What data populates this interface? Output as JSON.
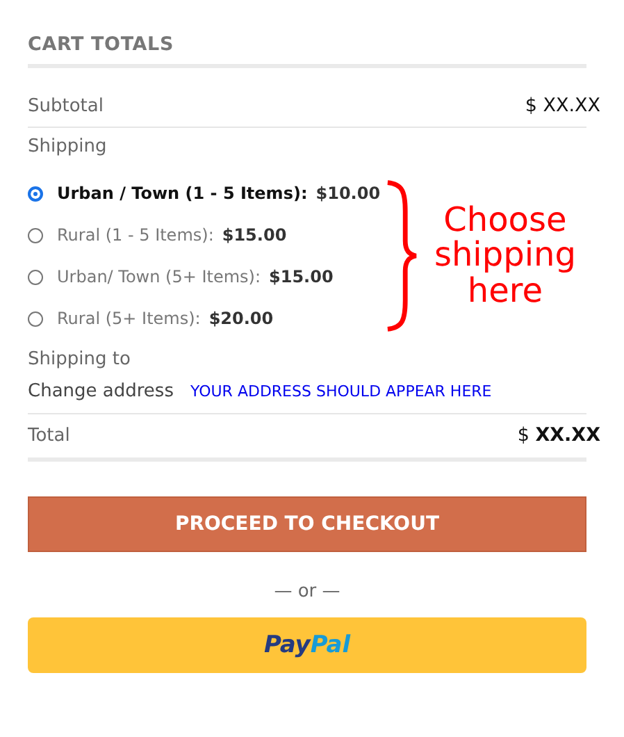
{
  "title": "CART TOTALS",
  "subtotal": {
    "label": "Subtotal",
    "value": "$ XX.XX"
  },
  "shipping": {
    "label": "Shipping",
    "options": [
      {
        "label": "Urban / Town (1 - 5 Items):",
        "price": "$10.00",
        "selected": true
      },
      {
        "label": "Rural (1 - 5 Items):",
        "price": "$15.00",
        "selected": false
      },
      {
        "label": "Urban/ Town (5+ Items):",
        "price": "$15.00",
        "selected": false
      },
      {
        "label": "Rural (5+ Items):",
        "price": "$20.00",
        "selected": false
      }
    ],
    "annotation": "Choose shipping here",
    "shipping_to": "Shipping to",
    "change_address": "Change address",
    "address": "YOUR ADDRESS SHOULD APPEAR HERE"
  },
  "total": {
    "label": "Total",
    "currency": "$",
    "value": "XX.XX"
  },
  "checkout_button": "PROCEED TO CHECKOUT",
  "separator": "— or —",
  "paypal_button": {
    "part_1": "Pay",
    "part_2": "Pal"
  }
}
